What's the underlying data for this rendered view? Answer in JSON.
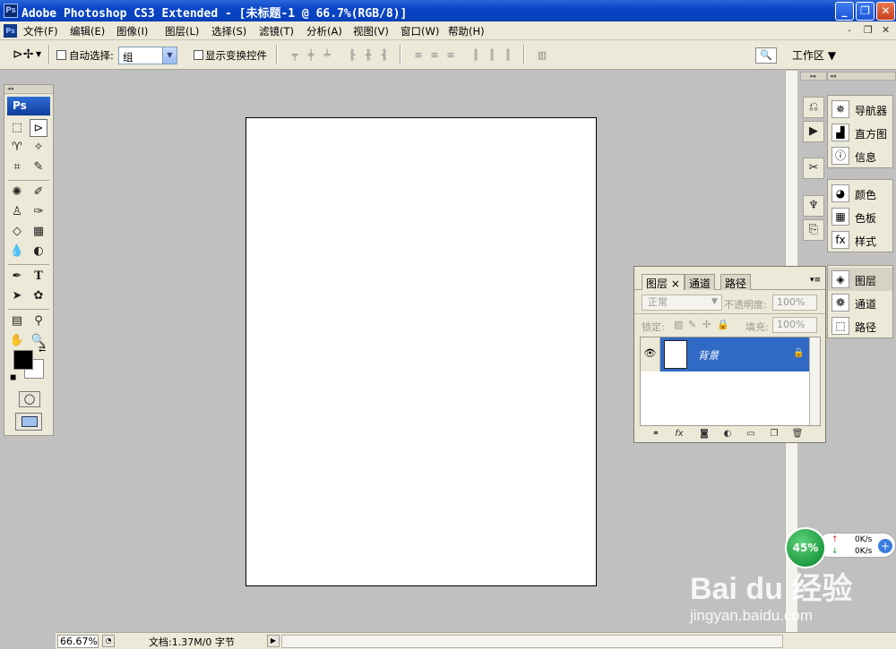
{
  "window": {
    "title": "Adobe Photoshop CS3 Extended - [未标题-1 @ 66.7%(RGB/8)]",
    "app_icon": "Ps",
    "minimize": "_",
    "maximize": "❐",
    "close": "✕"
  },
  "menu": {
    "items": [
      "文件(F)",
      "编辑(E)",
      "图像(I)",
      "图层(L)",
      "选择(S)",
      "滤镜(T)",
      "分析(A)",
      "视图(V)",
      "窗口(W)",
      "帮助(H)"
    ],
    "doc_controls": [
      "-",
      "❐",
      "✕"
    ]
  },
  "options": {
    "auto_select_label": "自动选择:",
    "auto_select_value": "组",
    "show_transform_label": "显示变换控件",
    "workspace_label": "工作区 ▼"
  },
  "tools": {
    "logo": "Ps",
    "head": "◂◂"
  },
  "dock": {
    "head": "▸▸"
  },
  "groups": {
    "head": "◂◂",
    "g1": [
      "导航器",
      "直方图",
      "信息"
    ],
    "g2": [
      "颜色",
      "色板",
      "样式"
    ],
    "g3": [
      "图层",
      "通道",
      "路径"
    ]
  },
  "layers_panel": {
    "tabs": [
      "图层",
      "通道",
      "路径"
    ],
    "tab_close": "×",
    "menu_btn": "▾≡",
    "blend_mode": "正常",
    "opacity_label": "不透明度:",
    "opacity_value": "100%",
    "lock_label": "锁定:",
    "fill_label": "填充:",
    "fill_value": "100%",
    "layer_name": "背景"
  },
  "status": {
    "zoom": "66.67%",
    "doc_info": "文档:1.37M/0 字节"
  },
  "speed_widget": {
    "percent": "45%",
    "up": "0K/s",
    "down": "0K/s"
  },
  "watermark": {
    "brand": "Bai du 经验",
    "url": "jingyan.baidu.com"
  },
  "colors": {
    "titlebar": "#0a45c8",
    "selected_layer": "#316ac5",
    "workspace": "#c0c0c0"
  }
}
